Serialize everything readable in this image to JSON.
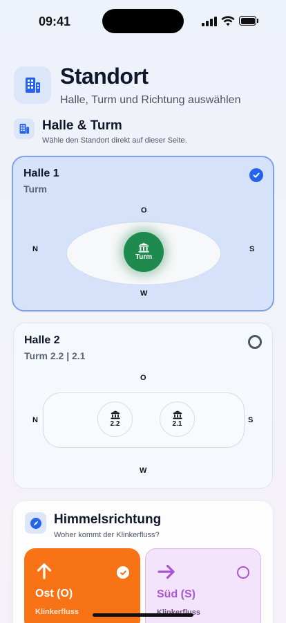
{
  "status_bar": {
    "time": "09:41"
  },
  "header": {
    "icon": "building-icon",
    "title": "Standort",
    "subtitle": "Halle, Turm und Richtung auswählen"
  },
  "hall_section": {
    "icon": "building-icon",
    "title": "Halle & Turm",
    "subtitle": "Wähle den Standort direkt auf dieser Seite."
  },
  "halls": [
    {
      "title": "Halle 1",
      "subtitle": "Turm",
      "selected": true,
      "compass": {
        "north": "N",
        "east": "O",
        "south": "S",
        "west": "W"
      },
      "towers": [
        "Turm"
      ]
    },
    {
      "title": "Halle 2",
      "subtitle": "Turm 2.2 | 2.1",
      "selected": false,
      "compass": {
        "north": "N",
        "east": "O",
        "south": "S",
        "west": "W"
      },
      "towers": [
        "2.2",
        "2.1"
      ]
    }
  ],
  "direction_section": {
    "icon": "compass-icon",
    "title": "Himmelsrichtung",
    "subtitle": "Woher kommt der Klinkerfluss?",
    "options": [
      {
        "label": "Ost (O)",
        "caption": "Klinkerfluss",
        "selected": true,
        "color": "#f77316"
      },
      {
        "label": "Süd (S)",
        "caption": "Klinkerfluss",
        "selected": false,
        "color": "#a855cf"
      }
    ]
  },
  "colors": {
    "accent": "#2563eb",
    "tower_selected": "#1f8a4d"
  }
}
